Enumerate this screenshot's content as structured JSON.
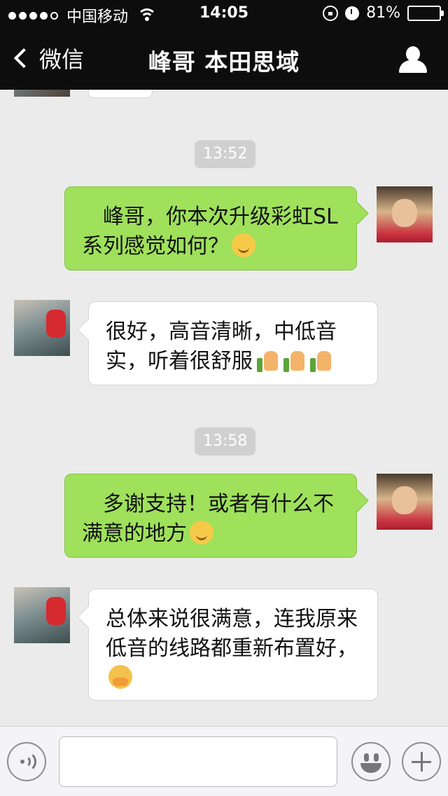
{
  "status_bar": {
    "signal_dots_filled": 4,
    "signal_dots_total": 5,
    "carrier": "中国移动",
    "time": "14:05",
    "battery": "81%",
    "battery_level": 0.81
  },
  "nav": {
    "back_label": "微信",
    "title": "峰哥 本田思域"
  },
  "messages": [
    {
      "type": "timestamp",
      "text": "13:52"
    },
    {
      "type": "message",
      "from": "me",
      "text": "　峰哥，你本次升级彩虹SL系列感觉如何？",
      "emoji": [
        "smile"
      ]
    },
    {
      "type": "message",
      "from": "friend",
      "text": "很好，高音清晰，中低音实，听着很舒服",
      "emoji": [
        "thumbs-up",
        "thumbs-up",
        "thumbs-up"
      ]
    },
    {
      "type": "timestamp",
      "text": "13:58"
    },
    {
      "type": "message",
      "from": "me",
      "text": "　多谢支持！或者有什么不满意的地方",
      "emoji": [
        "smile"
      ]
    },
    {
      "type": "message",
      "from": "friend",
      "text": "总体来说很满意，连我原来低音的线路都重新布置好，",
      "emoji": [
        "shy-hands"
      ]
    }
  ],
  "input_bar": {
    "value": "",
    "placeholder": ""
  },
  "colors": {
    "nav_bg": "#0d0d0d",
    "chat_bg": "#ebebeb",
    "my_bubble": "#9fe15b",
    "friend_bubble": "#ffffff",
    "timestamp_bg": "#d0d0d0"
  }
}
